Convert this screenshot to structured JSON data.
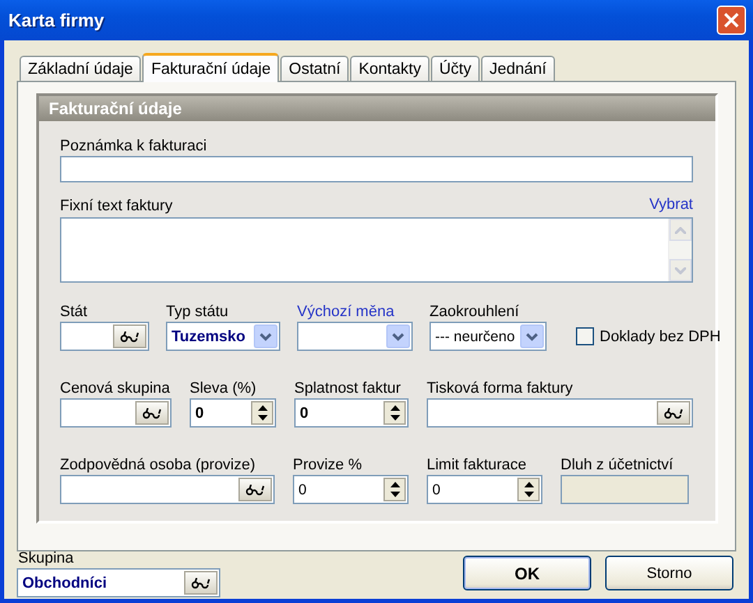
{
  "window": {
    "title": "Karta firmy"
  },
  "tabs": [
    {
      "label": "Základní údaje",
      "selected": false
    },
    {
      "label": "Fakturační údaje",
      "selected": true
    },
    {
      "label": "Ostatní",
      "selected": false
    },
    {
      "label": "Kontakty",
      "selected": false
    },
    {
      "label": "Účty",
      "selected": false
    },
    {
      "label": "Jednání",
      "selected": false
    }
  ],
  "group": {
    "title": "Fakturační údaje",
    "note": {
      "label": "Poznámka k fakturaci"
    },
    "fixed_text": {
      "label": "Fixní text faktury",
      "link": "Vybrat"
    },
    "rows": [
      {
        "fields": [
          {
            "kind": "lookup",
            "label": "Stát",
            "label_link": false
          },
          {
            "kind": "combo",
            "label": "Typ státu",
            "label_link": false,
            "value": "Tuzemsko",
            "bold": true,
            "highlighted": true
          },
          {
            "kind": "combo",
            "label": "Výchozí měna",
            "label_link": true
          },
          {
            "kind": "combo",
            "label": "Zaokrouhlení",
            "label_link": false,
            "value": "--- neurčeno",
            "bold": false,
            "highlighted": false
          },
          {
            "kind": "checkbox",
            "label": "Doklady bez DPH",
            "checked": false
          }
        ]
      },
      {
        "fields": [
          {
            "kind": "lookup",
            "label": "Cenová skupina",
            "label_link": false
          },
          {
            "kind": "spinner",
            "label": "Sleva (%)",
            "label_link": false,
            "value": "0",
            "bold": true,
            "highlighted": false
          },
          {
            "kind": "spinner",
            "label": "Splatnost faktur",
            "label_link": false,
            "value": "0",
            "bold": true,
            "highlighted": false
          },
          {
            "kind": "lookup",
            "label": "Tisková forma faktury",
            "label_link": false
          }
        ]
      },
      {
        "fields": [
          {
            "kind": "lookup",
            "label": "Zodpovědná osoba (provize)",
            "label_link": false
          },
          {
            "kind": "spinner",
            "label": "Provize %",
            "label_link": false,
            "value": "0",
            "bold": false,
            "highlighted": false
          },
          {
            "kind": "spinner",
            "label": "Limit fakturace",
            "label_link": false,
            "value": "0",
            "bold": false,
            "highlighted": false
          },
          {
            "kind": "readonly",
            "label": "Dluh z účetnictví",
            "label_link": false
          }
        ]
      }
    ]
  },
  "group_field": {
    "kind": "lookup",
    "label": "Skupina",
    "value": "Obchodníci",
    "bold": true,
    "highlighted": true
  },
  "buttons": [
    {
      "label": "OK",
      "default": true
    },
    {
      "label": "Storno",
      "default": false
    }
  ]
}
